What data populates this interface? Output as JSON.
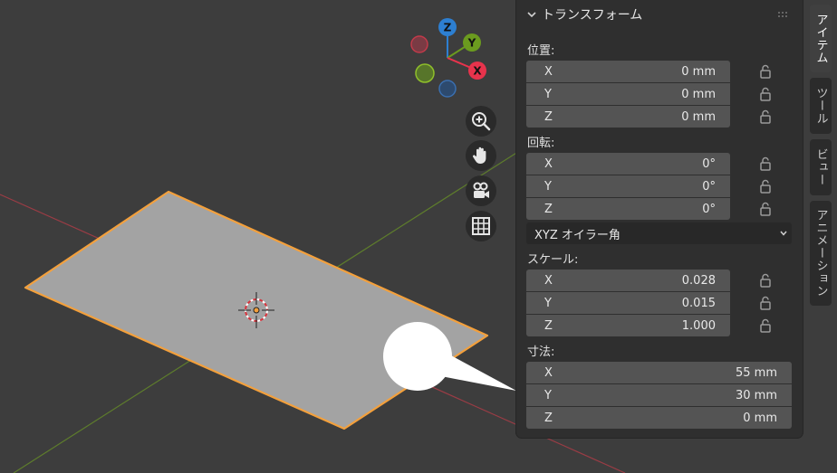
{
  "gizmo": {
    "z_label": "Z",
    "y_label": "Y",
    "x_label": "X",
    "colors": {
      "x": "#e8334c",
      "y": "#6b9b1f",
      "z": "#2d7fd1"
    }
  },
  "nav_icons": [
    "zoom-icon",
    "pan-hand-icon",
    "camera-icon",
    "grid-icon"
  ],
  "panel": {
    "title": "トランスフォーム",
    "location": {
      "label": "位置:",
      "fields": [
        {
          "axis": "X",
          "value": "0 mm"
        },
        {
          "axis": "Y",
          "value": "0 mm"
        },
        {
          "axis": "Z",
          "value": "0 mm"
        }
      ]
    },
    "rotation": {
      "label": "回転:",
      "fields": [
        {
          "axis": "X",
          "value": "0°"
        },
        {
          "axis": "Y",
          "value": "0°"
        },
        {
          "axis": "Z",
          "value": "0°"
        }
      ],
      "mode": "XYZ オイラー角"
    },
    "scale": {
      "label": "スケール:",
      "fields": [
        {
          "axis": "X",
          "value": "0.028"
        },
        {
          "axis": "Y",
          "value": "0.015"
        },
        {
          "axis": "Z",
          "value": "1.000"
        }
      ]
    },
    "dimensions": {
      "label": "寸法:",
      "fields": [
        {
          "axis": "X",
          "value": "55 mm"
        },
        {
          "axis": "Y",
          "value": "30 mm"
        },
        {
          "axis": "Z",
          "value": "0 mm"
        }
      ]
    }
  },
  "tabs": [
    {
      "label": "アイテム",
      "active": true
    },
    {
      "label": "ツール",
      "active": false
    },
    {
      "label": "ビュー",
      "active": false
    },
    {
      "label": "アニメーション",
      "active": false
    }
  ],
  "colors": {
    "background": "#3d3d3d",
    "plane_fill": "#a3a3a3",
    "plane_outline": "#f3a03c",
    "panel_bg": "#2f2f2f",
    "field_bg": "#545454"
  }
}
